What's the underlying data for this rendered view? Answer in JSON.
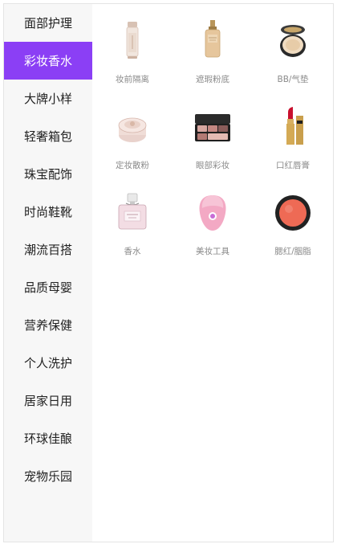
{
  "sidebar": {
    "items": [
      {
        "label": "面部护理",
        "active": false
      },
      {
        "label": "彩妆香水",
        "active": true
      },
      {
        "label": "大牌小样",
        "active": false
      },
      {
        "label": "轻奢箱包",
        "active": false
      },
      {
        "label": "珠宝配饰",
        "active": false
      },
      {
        "label": "时尚鞋靴",
        "active": false
      },
      {
        "label": "潮流百搭",
        "active": false
      },
      {
        "label": "品质母婴",
        "active": false
      },
      {
        "label": "营养保健",
        "active": false
      },
      {
        "label": "个人洗护",
        "active": false
      },
      {
        "label": "居家日用",
        "active": false
      },
      {
        "label": "环球佳酿",
        "active": false
      },
      {
        "label": "宠物乐园",
        "active": false
      }
    ],
    "active_color": "#8b3ff5"
  },
  "categories": [
    {
      "label": "妆前隔离",
      "icon": "primer-tube-icon"
    },
    {
      "label": "遮瑕粉底",
      "icon": "foundation-bottle-icon"
    },
    {
      "label": "BB/气垫",
      "icon": "cushion-compact-icon"
    },
    {
      "label": "定妆散粉",
      "icon": "loose-powder-jar-icon"
    },
    {
      "label": "眼部彩妆",
      "icon": "eyeshadow-palette-icon"
    },
    {
      "label": "口红唇膏",
      "icon": "lipstick-icon"
    },
    {
      "label": "香水",
      "icon": "perfume-bottle-icon"
    },
    {
      "label": "美妆工具",
      "icon": "cleansing-device-icon"
    },
    {
      "label": "腮红/胭脂",
      "icon": "blush-compact-icon"
    }
  ]
}
